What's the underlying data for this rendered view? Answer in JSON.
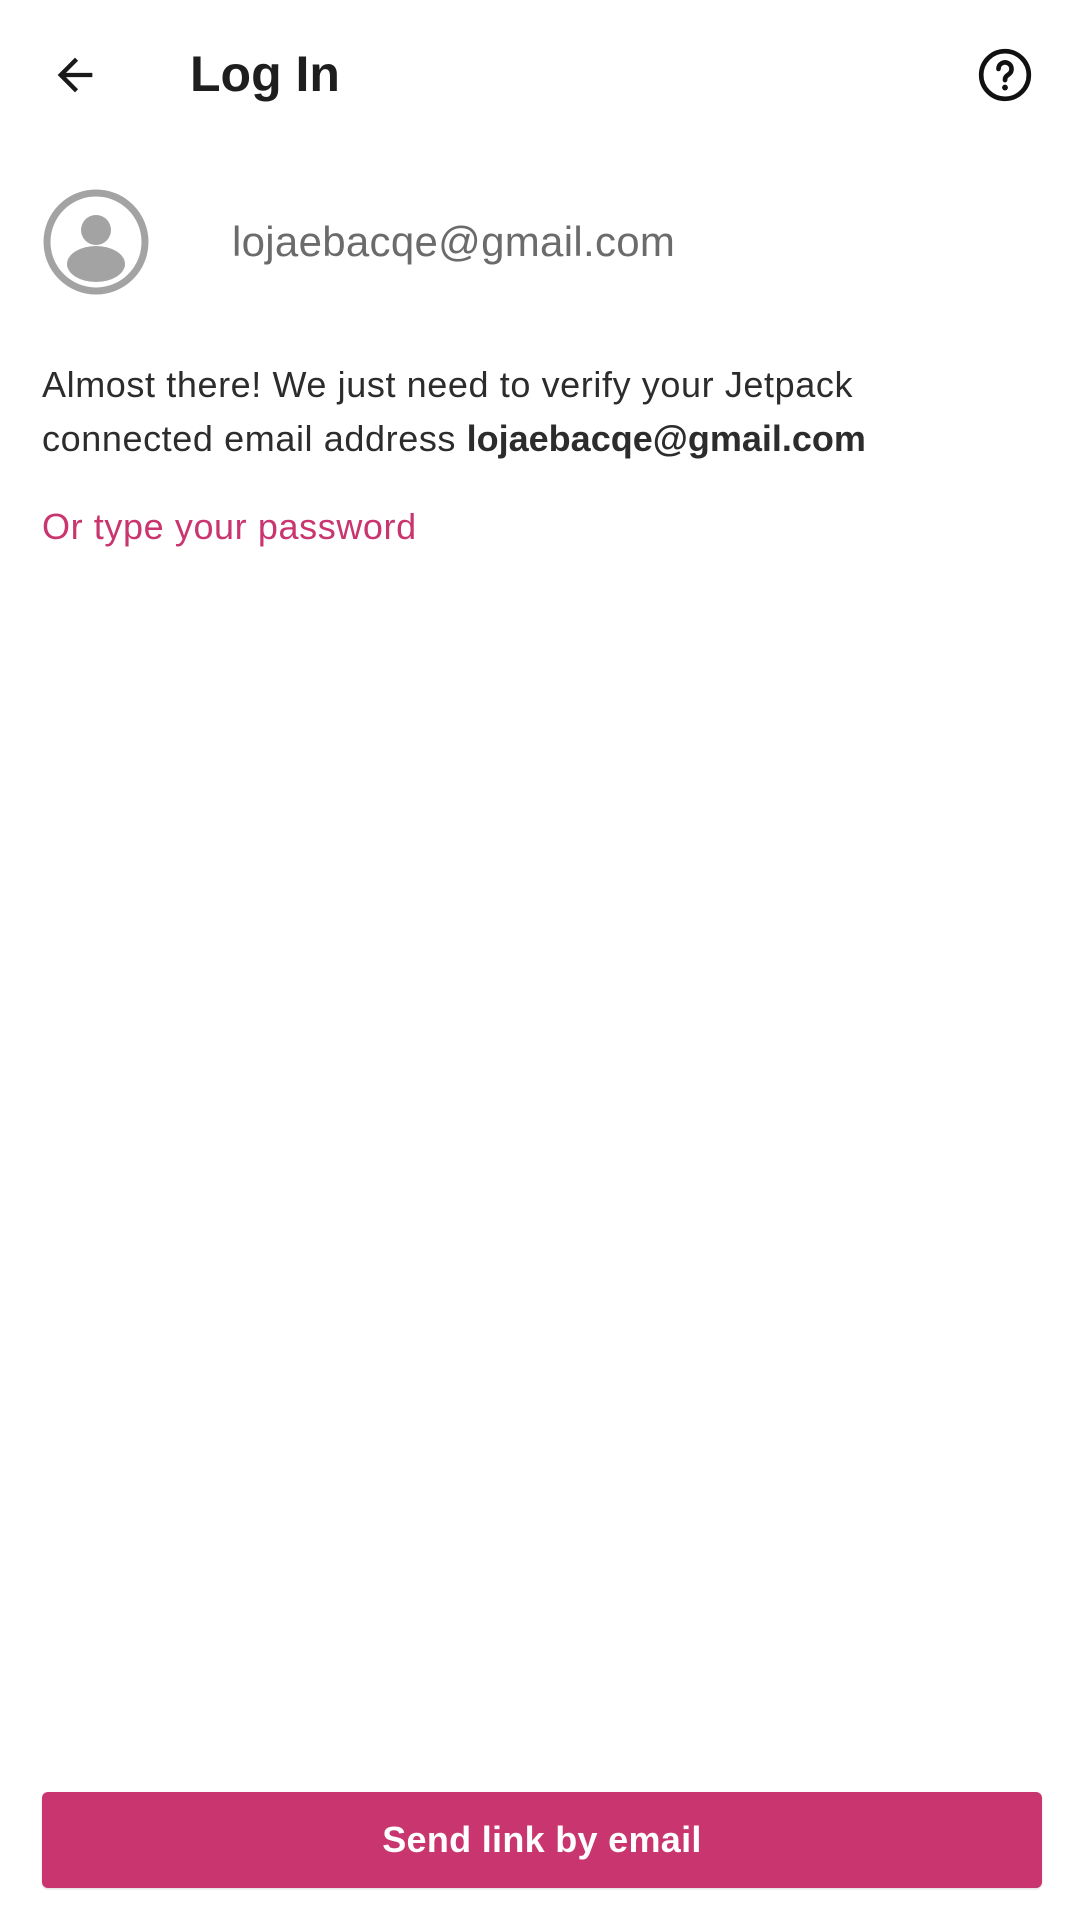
{
  "topbar": {
    "title": "Log In",
    "back_icon": "arrow-left-icon",
    "help_icon": "help-circle-icon"
  },
  "account": {
    "avatar_icon": "user-avatar-icon",
    "email": "lojaebacqe@gmail.com"
  },
  "message": {
    "text_line1": "Almost there! We just need to verify your Jetpack",
    "text_prefix": "connected email address ",
    "email_bold": "lojaebacqe@gmail.com"
  },
  "links": {
    "password": "Or type your password"
  },
  "actions": {
    "send_link": "Send link by email"
  },
  "colors": {
    "accent": "#c9356e",
    "title_text": "#1e1e1e",
    "body_text": "#2c2c2c",
    "muted_text": "#6b6b6b",
    "avatar_gray": "#a3a3a3"
  }
}
